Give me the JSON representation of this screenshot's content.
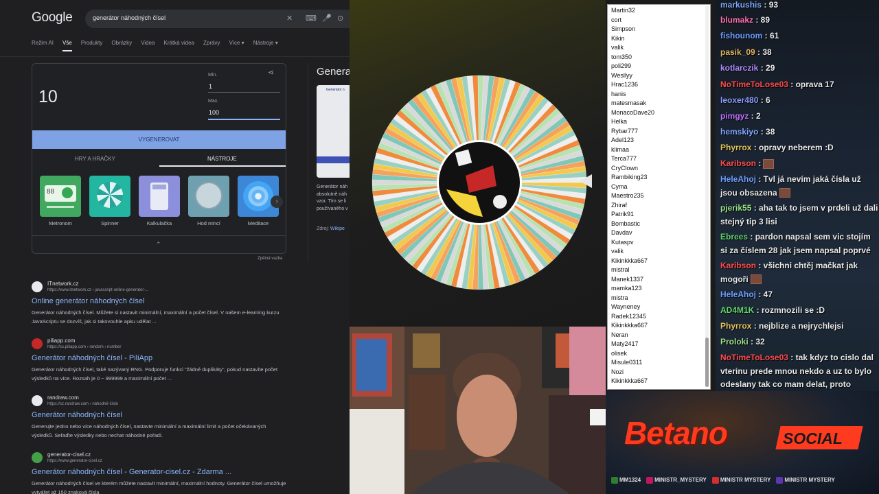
{
  "google": {
    "logo": "Google",
    "query": "generátor náhodných čísel",
    "tabs": [
      "Režim AI",
      "Vše",
      "Produkty",
      "Obrázky",
      "Videa",
      "Krátká videa",
      "Zprávy",
      "Více ▾",
      "Nástroje ▾"
    ],
    "active_tab": "Vše",
    "rng": {
      "result": "10",
      "min_label": "Min.",
      "min_value": "1",
      "max_label": "Max.",
      "max_value": "100",
      "generate_label": "VYGENEROVAT",
      "tab_games": "HRY A HRAČKY",
      "tab_tools": "NÁSTROJE",
      "tools": [
        "Metronom",
        "Spinner",
        "Kalkulačka",
        "Hod mincí",
        "Meditace"
      ],
      "metronome_bpm": "88",
      "collapse_icon": "chevron-up-icon"
    },
    "feedback": "Zpětná vazba",
    "side": {
      "title": "Genera",
      "thumb_header": "Generátor n",
      "desc": [
        "Generátor náh",
        "absolutně náh",
        "vzor. Tím se li",
        "používaného v"
      ],
      "src_label": "Zdroj:",
      "src_link": "Wikipe"
    },
    "results": [
      {
        "site": "ITnetwork.cz",
        "url": "https://www.itnetwork.cz › javascript-online-generator-...",
        "title": "Online generátor náhodných čísel",
        "snippet": "Generátor náhodných čísel. Můžete si nastavit minimální, maximální a počet čísel. V našem e-learning kurzu JavaScriptu se dozvíš, jak si takovouhle apku udělat ...",
        "fav_color": "#e8eaed"
      },
      {
        "site": "piliapp.com",
        "url": "https://cs.piliapp.com › random › number",
        "title": "Generátor náhodných čísel - PiliApp",
        "snippet": "Generátor náhodných čísel, také nazývaný RNG. Podporuje funkci \"žádné duplikáty\", pokud nastavíte počet výsledků na více. Rozsah je 0 ~ 999999 a maximální počet ...",
        "fav_color": "#c62828"
      },
      {
        "site": "randraw.com",
        "url": "https://cz.randraw.com › náhodné-číslo",
        "title": "Generátor náhodných čísel",
        "snippet": "Generujte jedno nebo více náhodných čísel, nastavte minimální a maximální limit a počet očekávaných výsledků. Seřaďte výsledky nebo nechat náhodné pořadí.",
        "fav_color": "#e8eaed"
      },
      {
        "site": "generator-cisel.cz",
        "url": "https://www.generator-cisel.cz",
        "title": "Generátor náhodných čísel - Generator-cisel.cz - Zdarma ...",
        "snippet": "Generátor náhodných čísel ve kterém můžete nastavit minimální, maximální hodnoty. Generátor čísel umožňuje vytvářet až 150 znaková čísla",
        "fav_color": "#43a047"
      }
    ]
  },
  "names": [
    "Martin32",
    "cort",
    "Simpson",
    "Kikin",
    "valik",
    "tom350",
    "poli299",
    "Wesllyy",
    "Hrac1236",
    "hanis",
    "matesmasak",
    "MonacoDave20",
    "Helka",
    "Rybar777",
    "Adel123",
    "klimaa",
    "Terca777",
    "CryClown",
    "Rambiking23",
    "Cyma",
    "Maestro235",
    "Zhiraf",
    "Patrik91",
    "Bombastic",
    "Davdav",
    "Kutaspv",
    "valik",
    "Kikinkkka667",
    "mistral",
    "Manek1337",
    "mamka123",
    "mistra",
    "Wayneney",
    "Radek12345",
    "Kikinkkka667",
    "Neran",
    "Maty2417",
    "olisek",
    "Misule0311",
    "Nozi",
    "Kikinkkka667"
  ],
  "chat": [
    {
      "user": "markushis",
      "color": "#7fa7ff",
      "text": " : 93",
      "emote": false
    },
    {
      "user": "blumakz",
      "color": "#ff6fae",
      "text": " : 89",
      "emote": false
    },
    {
      "user": "fishounom",
      "color": "#6f9dff",
      "text": " : 61",
      "emote": false
    },
    {
      "user": "pasik_09",
      "color": "#e0b060",
      "text": " : 38",
      "emote": false
    },
    {
      "user": "kotlarczik",
      "color": "#b28cff",
      "text": " : 29",
      "emote": false
    },
    {
      "user": "NoTimeToLose03",
      "color": "#ff4a4a",
      "text": " : oprava 17",
      "emote": false
    },
    {
      "user": "leoxer480",
      "color": "#8a9cff",
      "text": " : 6",
      "emote": false
    },
    {
      "user": "pimgyz",
      "color": "#c070ff",
      "text": " : 2",
      "emote": false
    },
    {
      "user": "hemskiyo",
      "color": "#7fa7ff",
      "text": " : 38",
      "emote": false
    },
    {
      "user": "Phyrrox",
      "color": "#e6c45a",
      "text": " : opravy neberem :D",
      "emote": false
    },
    {
      "user": "Karibson",
      "color": "#ff4a4a",
      "text": " :",
      "emote": true
    },
    {
      "user": "HeleAhoj",
      "color": "#6fa0ff",
      "text": " : Tvl já nevím jaká čísla už jsou obsazena",
      "emote": true
    },
    {
      "user": "pjerik55",
      "color": "#9be08a",
      "text": " : aha tak to jsem v prdeli už dali stejný tip 3 lisi",
      "emote": false
    },
    {
      "user": "Ebrees",
      "color": "#5fd06f",
      "text": " : pardon napsal sem vic stojím si za číslem 28 jak jsem napsal poprvé",
      "emote": false
    },
    {
      "user": "Karibson",
      "color": "#ff4a4a",
      "text": " : všichni chtěj mačkat jak mogoři",
      "emote": true
    },
    {
      "user": "HeleAhoj",
      "color": "#6fa0ff",
      "text": " : 47",
      "emote": false
    },
    {
      "user": "AD4M1K",
      "color": "#62d66a",
      "text": " : rozmnozili se :D",
      "emote": false
    },
    {
      "user": "Phyrrox",
      "color": "#e6c45a",
      "text": " : nejblize a nejrychlejsi",
      "emote": false
    },
    {
      "user": "Proloki",
      "color": "#9be08a",
      "text": " : 32",
      "emote": false
    },
    {
      "user": "NoTimeToLose03",
      "color": "#ff4a4a",
      "text": " : tak kdyz to cislo dal vterinu prede mnou nekdo a uz to bylo odeslany tak co mam delat, proto oprava",
      "emote": false
    }
  ],
  "brand": {
    "betano": "Betano",
    "social": "SOCIAL",
    "socials": [
      "MM1324",
      "MINISTR_MYSTERY",
      "MINISTR MYSTERY",
      "MINISTR MYSTERY"
    ]
  },
  "wheel": {
    "segment_colors": [
      "#f2c94c",
      "#9ad0c2",
      "#eeeeee",
      "#f08a3c",
      "#b7e3b0",
      "#d9d9d9",
      "#7fc8b8",
      "#f5a25d"
    ]
  }
}
